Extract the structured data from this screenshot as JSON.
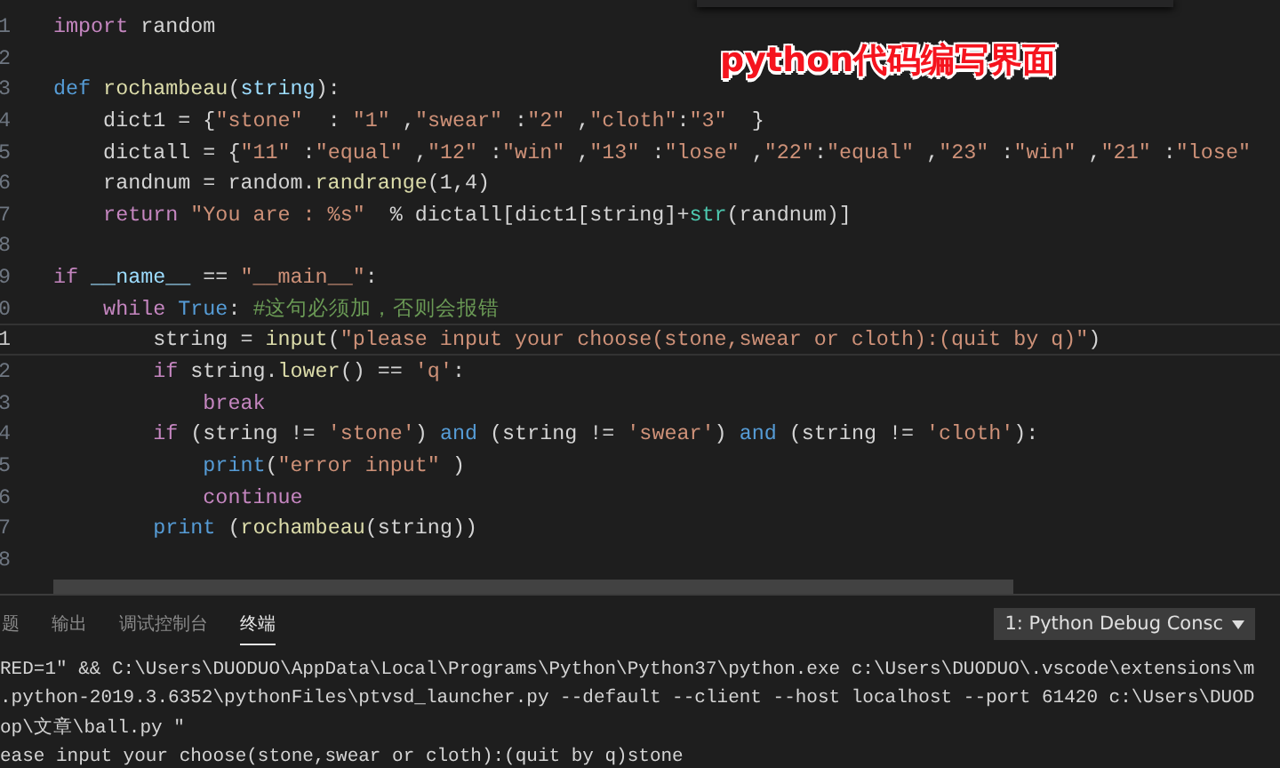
{
  "editor": {
    "overlay_caption": "python代码编写界面",
    "lines": [
      {
        "number": "1",
        "current": false,
        "tokens": [
          {
            "text": "import",
            "kind": "keyword"
          },
          {
            "text": " random",
            "kind": "plain"
          }
        ]
      },
      {
        "number": "2",
        "current": false
      },
      {
        "number": "3",
        "current": false,
        "tokens": [
          {
            "text": "def",
            "kind": "storage"
          },
          {
            "text": " rochambeau",
            "kind": "function"
          },
          {
            "text": "(",
            "kind": "plain"
          },
          {
            "text": "string",
            "kind": "variable"
          },
          {
            "text": "):",
            "kind": "plain"
          }
        ]
      },
      {
        "number": "4",
        "current": false,
        "tokens": [
          {
            "text": "    dict1 = {",
            "kind": "plain"
          },
          {
            "text": "\"stone\"",
            "kind": "string"
          },
          {
            "text": "  : ",
            "kind": "plain"
          },
          {
            "text": "\"1\"",
            "kind": "string"
          },
          {
            "text": " ,",
            "kind": "plain"
          },
          {
            "text": "\"swear\"",
            "kind": "string"
          },
          {
            "text": " :",
            "kind": "plain"
          },
          {
            "text": "\"2\"",
            "kind": "string"
          },
          {
            "text": " ,",
            "kind": "plain"
          },
          {
            "text": "\"cloth\"",
            "kind": "string"
          },
          {
            "text": ":",
            "kind": "plain"
          },
          {
            "text": "\"3\"",
            "kind": "string"
          },
          {
            "text": "  }",
            "kind": "plain"
          }
        ]
      },
      {
        "number": "5",
        "current": false,
        "tokens": [
          {
            "text": "    dictall = {",
            "kind": "plain"
          },
          {
            "text": "\"11\"",
            "kind": "string"
          },
          {
            "text": " :",
            "kind": "plain"
          },
          {
            "text": "\"equal\"",
            "kind": "string"
          },
          {
            "text": " ,",
            "kind": "plain"
          },
          {
            "text": "\"12\"",
            "kind": "string"
          },
          {
            "text": " :",
            "kind": "plain"
          },
          {
            "text": "\"win\"",
            "kind": "string"
          },
          {
            "text": " ,",
            "kind": "plain"
          },
          {
            "text": "\"13\"",
            "kind": "string"
          },
          {
            "text": " :",
            "kind": "plain"
          },
          {
            "text": "\"lose\"",
            "kind": "string"
          },
          {
            "text": " ,",
            "kind": "plain"
          },
          {
            "text": "\"22\"",
            "kind": "string"
          },
          {
            "text": ":",
            "kind": "plain"
          },
          {
            "text": "\"equal\"",
            "kind": "string"
          },
          {
            "text": " ,",
            "kind": "plain"
          },
          {
            "text": "\"23\"",
            "kind": "string"
          },
          {
            "text": " :",
            "kind": "plain"
          },
          {
            "text": "\"win\"",
            "kind": "string"
          },
          {
            "text": " ,",
            "kind": "plain"
          },
          {
            "text": "\"21\"",
            "kind": "string"
          },
          {
            "text": " :",
            "kind": "plain"
          },
          {
            "text": "\"lose\"",
            "kind": "string"
          }
        ]
      },
      {
        "number": "6",
        "current": false,
        "tokens": [
          {
            "text": "    randnum = random.",
            "kind": "plain"
          },
          {
            "text": "randrange",
            "kind": "function"
          },
          {
            "text": "(1,4)",
            "kind": "plain"
          }
        ]
      },
      {
        "number": "7",
        "current": false,
        "tokens": [
          {
            "text": "    return",
            "kind": "keyword"
          },
          {
            "text": " \"You are : %s\"",
            "kind": "string"
          },
          {
            "text": "  % dictall[dict1[string]+",
            "kind": "plain"
          },
          {
            "text": "str",
            "kind": "builtin"
          },
          {
            "text": "(randnum)]",
            "kind": "plain"
          }
        ]
      },
      {
        "number": "8",
        "current": false
      },
      {
        "number": "9",
        "current": false,
        "tokens": [
          {
            "text": "if",
            "kind": "keyword"
          },
          {
            "text": " __name__",
            "kind": "variable"
          },
          {
            "text": " == ",
            "kind": "plain"
          },
          {
            "text": "\"__main__\"",
            "kind": "string"
          },
          {
            "text": ":",
            "kind": "plain"
          }
        ]
      },
      {
        "number": "0",
        "current": false,
        "tokens": [
          {
            "text": "    while",
            "kind": "keyword"
          },
          {
            "text": " True",
            "kind": "storage"
          },
          {
            "text": ": ",
            "kind": "plain"
          },
          {
            "text": "#这句必须加，否则会报错",
            "kind": "comment"
          }
        ]
      },
      {
        "number": "1",
        "current": true,
        "tokens": [
          {
            "text": "        string = ",
            "kind": "plain"
          },
          {
            "text": "input",
            "kind": "function"
          },
          {
            "text": "(",
            "kind": "plain"
          },
          {
            "text": "\"please input your choose(stone,swear or cloth):(quit by q)\"",
            "kind": "string"
          },
          {
            "text": ")",
            "kind": "plain"
          }
        ]
      },
      {
        "number": "2",
        "current": false,
        "tokens": [
          {
            "text": "        if",
            "kind": "keyword"
          },
          {
            "text": " string.",
            "kind": "plain"
          },
          {
            "text": "lower",
            "kind": "function"
          },
          {
            "text": "() == ",
            "kind": "plain"
          },
          {
            "text": "'q'",
            "kind": "string"
          },
          {
            "text": ":",
            "kind": "plain"
          }
        ]
      },
      {
        "number": "3",
        "current": false,
        "tokens": [
          {
            "text": "            break",
            "kind": "keyword"
          }
        ]
      },
      {
        "number": "4",
        "current": false,
        "tokens": [
          {
            "text": "        if",
            "kind": "keyword"
          },
          {
            "text": " (string != ",
            "kind": "plain"
          },
          {
            "text": "'stone'",
            "kind": "string"
          },
          {
            "text": ") ",
            "kind": "plain"
          },
          {
            "text": "and",
            "kind": "storage"
          },
          {
            "text": " (string != ",
            "kind": "plain"
          },
          {
            "text": "'swear'",
            "kind": "string"
          },
          {
            "text": ") ",
            "kind": "plain"
          },
          {
            "text": "and",
            "kind": "storage"
          },
          {
            "text": " (string != ",
            "kind": "plain"
          },
          {
            "text": "'cloth'",
            "kind": "string"
          },
          {
            "text": "):",
            "kind": "plain"
          }
        ]
      },
      {
        "number": "5",
        "current": false,
        "tokens": [
          {
            "text": "            print",
            "kind": "storage"
          },
          {
            "text": "(",
            "kind": "plain"
          },
          {
            "text": "\"error input\"",
            "kind": "string"
          },
          {
            "text": " )",
            "kind": "plain"
          }
        ]
      },
      {
        "number": "6",
        "current": false,
        "tokens": [
          {
            "text": "            continue",
            "kind": "keyword"
          }
        ]
      },
      {
        "number": "7",
        "current": false,
        "tokens": [
          {
            "text": "        print",
            "kind": "storage"
          },
          {
            "text": " (",
            "kind": "plain"
          },
          {
            "text": "rochambeau",
            "kind": "function"
          },
          {
            "text": "(string))",
            "kind": "plain"
          }
        ]
      },
      {
        "number": "8",
        "current": false
      }
    ]
  },
  "panel": {
    "tabs": [
      {
        "label": "题",
        "selected": false
      },
      {
        "label": "输出",
        "selected": false
      },
      {
        "label": "调试控制台",
        "selected": false
      },
      {
        "label": "终端",
        "selected": true
      }
    ],
    "terminal_select": "1: Python Debug Consc",
    "terminal_lines": [
      "RED=1\" && C:\\Users\\DUODUO\\AppData\\Local\\Programs\\Python\\Python37\\python.exe c:\\Users\\DUODUO\\.vscode\\extensions\\m",
      ".python-2019.3.6352\\pythonFiles\\ptvsd_launcher.py --default --client --host localhost --port 61420 c:\\Users\\DUOD",
      "op\\文章\\ball.py \"",
      "ease input your choose(stone,swear or cloth):(quit by q)stone"
    ]
  }
}
